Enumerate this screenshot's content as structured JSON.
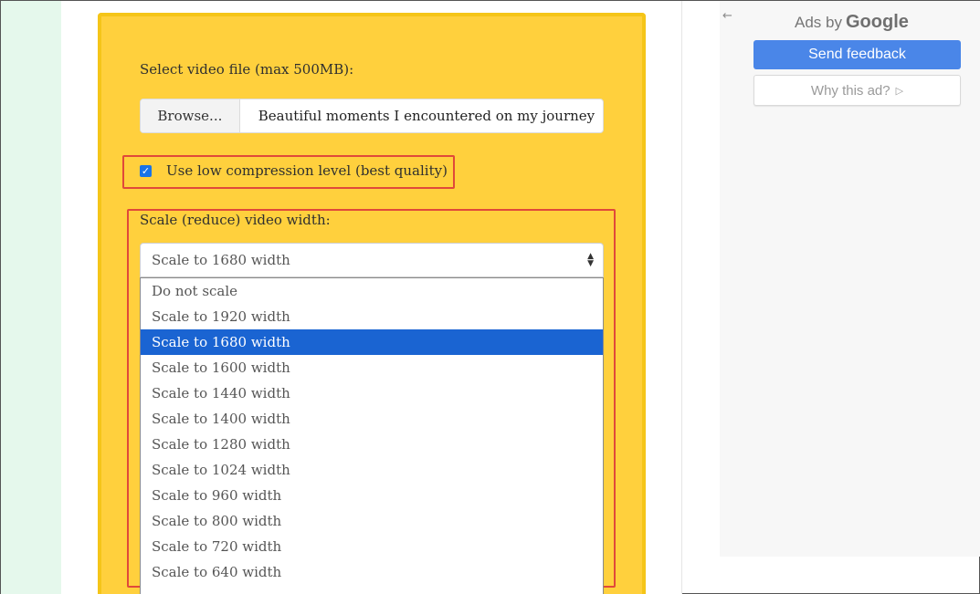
{
  "form": {
    "file_label": "Select video file (max 500MB):",
    "browse_label": "Browse...",
    "file_name": "Beautiful moments I encountered on my journey",
    "checkbox_label": "Use low compression level (best quality)",
    "checkbox_checked": true,
    "scale_label": "Scale (reduce) video width:",
    "scale_selected": "Scale to 1680 width",
    "scale_options": [
      "Do not scale",
      "Scale to 1920 width",
      "Scale to 1680 width",
      "Scale to 1600 width",
      "Scale to 1440 width",
      "Scale to 1400 width",
      "Scale to 1280 width",
      "Scale to 1024 width",
      "Scale to 960 width",
      "Scale to 800 width",
      "Scale to 720 width",
      "Scale to 640 width"
    ],
    "selected_index": 2
  },
  "ads": {
    "ads_by": "Ads by",
    "brand": "Google",
    "feedback_label": "Send feedback",
    "why_label": "Why this ad?"
  },
  "icons": {
    "back": "arrow-left-icon",
    "play": "adchoices-icon",
    "select_arrows": "sort-arrows-icon",
    "check": "checkmark-icon"
  },
  "colors": {
    "form_bg": "#ffd03d",
    "highlight": "#e0493a",
    "selected_option": "#1a64d2",
    "feedback_button": "#4a86e8"
  }
}
